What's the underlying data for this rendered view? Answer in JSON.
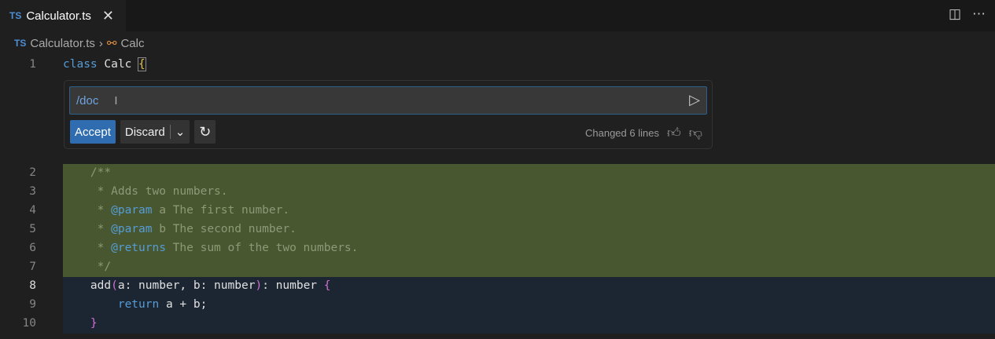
{
  "tab": {
    "lang": "TS",
    "title": "Calculator.ts"
  },
  "breadcrumb": {
    "file": "Calculator.ts",
    "symbol": "Calc"
  },
  "widget": {
    "input": "/doc",
    "accept": "Accept",
    "discard": "Discard",
    "status": "Changed 6 lines"
  },
  "code": {
    "l1": {
      "n": "1",
      "kw": "class",
      "name": "Calc",
      "brace": "{"
    },
    "l2": {
      "n": "2",
      "t": "    /**"
    },
    "l3": {
      "n": "3",
      "t": "     * Adds two numbers."
    },
    "l4": {
      "n": "4",
      "pre": "     * ",
      "tag": "@param",
      "t": " a The first number."
    },
    "l5": {
      "n": "5",
      "pre": "     * ",
      "tag": "@param",
      "t": " b The second number."
    },
    "l6": {
      "n": "6",
      "pre": "     * ",
      "tag": "@returns",
      "t": " The sum of the two numbers."
    },
    "l7": {
      "n": "7",
      "t": "     */"
    },
    "l8": {
      "n": "8",
      "a": "    add",
      "p1": "(",
      "b": "a: number, b: number",
      "p2": ")",
      "c": ": number ",
      "br": "{"
    },
    "l9": {
      "n": "9",
      "ind": "        ",
      "kw": "return",
      "t": " a + b;"
    },
    "l10": {
      "n": "10",
      "ind": "    ",
      "br": "}"
    }
  }
}
